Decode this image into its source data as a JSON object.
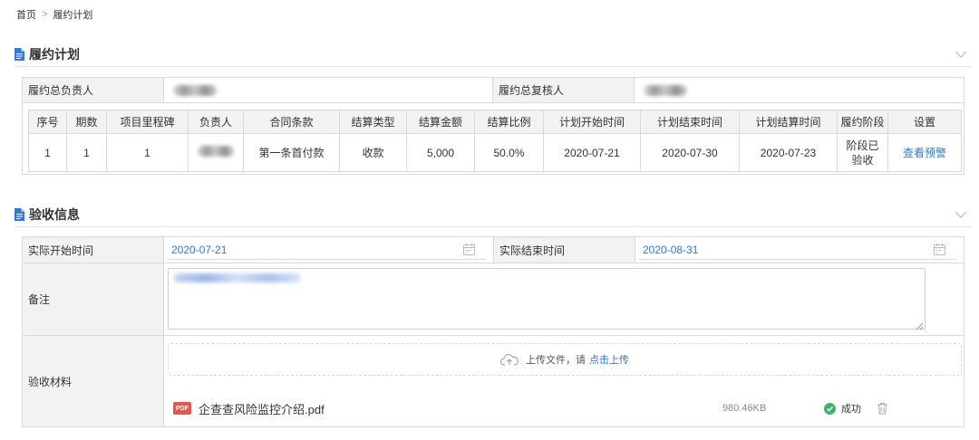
{
  "breadcrumb": {
    "home": "首页",
    "separator": ">",
    "current": "履约计划"
  },
  "plan_section": {
    "title": "履约计划",
    "owner_label": "履约总负责人",
    "reviewer_label": "履约总复核人",
    "table": {
      "headers": [
        "序号",
        "期数",
        "项目里程碑",
        "负责人",
        "合同条款",
        "结算类型",
        "结算金额",
        "结算比例",
        "计划开始时间",
        "计划结束时间",
        "计划结算时间",
        "履约阶段",
        "设置"
      ],
      "row": {
        "index": "1",
        "period": "1",
        "milestone": "1",
        "clause": "第一条首付款",
        "settle_type": "收款",
        "amount": "5,000",
        "ratio": "50.0%",
        "plan_start": "2020-07-21",
        "plan_end": "2020-07-30",
        "plan_settle": "2020-07-23",
        "stage": "阶段已验收",
        "action": "查看预警"
      }
    }
  },
  "acceptance_section": {
    "title": "验收信息",
    "actual_start_label": "实际开始时间",
    "actual_start_value": "2020-07-21",
    "actual_end_label": "实际结束时间",
    "actual_end_value": "2020-08-31",
    "remark_label": "备注",
    "material_label": "验收材料",
    "upload_text": "上传文件，请",
    "upload_link": "点击上传",
    "file": {
      "badge": "PDF",
      "name": "企查查风险监控介绍.pdf",
      "size": "980.46KB",
      "status": "成功"
    }
  },
  "colors": {
    "accent": "#2f7ad3",
    "success": "#3fb36b",
    "pdf": "#e8554e",
    "label_bg": "#f2f2f2"
  }
}
